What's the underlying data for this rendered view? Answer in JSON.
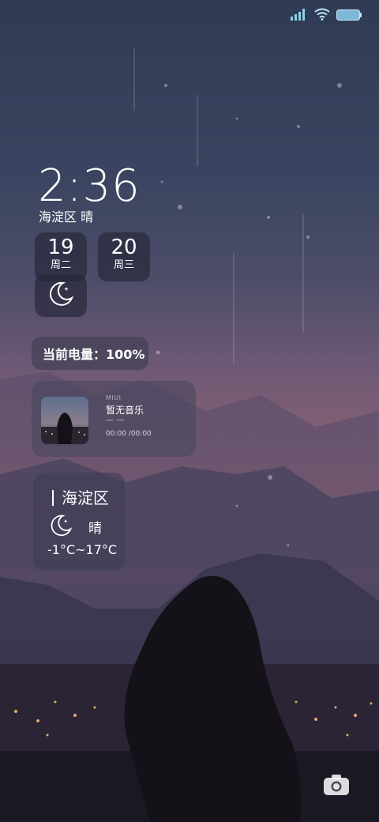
{
  "lockscreen": {
    "time": "2:36",
    "location_weather": "海淀区 晴",
    "dates": [
      {
        "day": "19",
        "weekday": "周二"
      },
      {
        "day": "20",
        "weekday": "周三"
      }
    ],
    "battery_label": "当前电量：100%",
    "music": {
      "source": "MIUI",
      "title": "暂无音乐",
      "artist": "— —",
      "time": "00:00 /00:00"
    },
    "weather": {
      "city": "海淀区",
      "condition": "晴",
      "temp_range": "-1°C~17°C",
      "icon": "moon-icon"
    }
  },
  "status": {
    "signal_icon": "signal-icon",
    "wifi_icon": "wifi-icon",
    "battery_icon": "battery-icon",
    "battery_color": "#7fb7d8"
  },
  "camera_icon": "camera-icon"
}
